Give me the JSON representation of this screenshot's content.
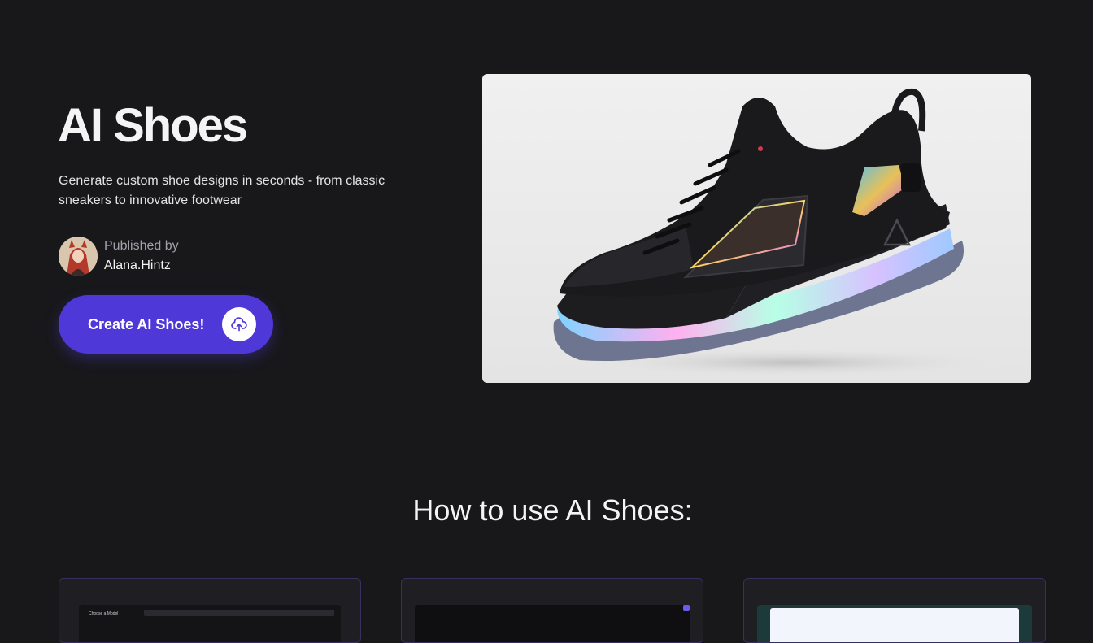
{
  "hero": {
    "title": "AI Shoes",
    "description": "Generate custom shoe designs in seconds - from classic sneakers to innovative footwear",
    "publisher": {
      "label": "Published by",
      "name": "Alana.Hintz"
    },
    "cta_label": "Create AI Shoes!",
    "cta_icon": "upload-cloud-icon",
    "image_alt": "black basketball sneaker with iridescent sole"
  },
  "how_to": {
    "title": "How to use AI Shoes:",
    "step1_caption": "Choose a Model"
  },
  "colors": {
    "background": "#18181b",
    "accent": "#4f38d8",
    "card_border": "#37315f"
  }
}
